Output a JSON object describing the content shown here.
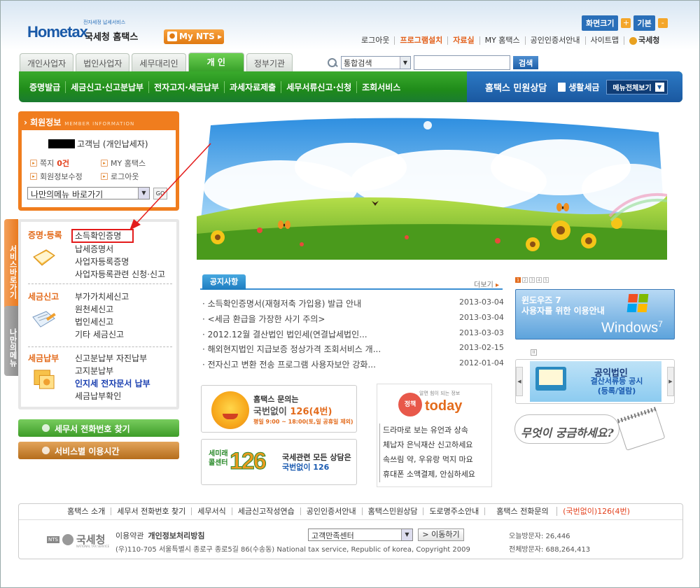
{
  "header": {
    "logo_brand": "Hometax",
    "logo_tag": "전자세정 납세서비스",
    "logo_name": "국세청 홈택스",
    "mynts_label": "My NTS",
    "font_size_label": "화면크기",
    "font_plus": "+",
    "font_default": "기본",
    "font_minus": "-",
    "top_links": [
      "로그아웃",
      "프로그램설치",
      "자료실",
      "MY 홈택스",
      "공인인증서안내",
      "사이트맵"
    ],
    "nts_badge": "국세청"
  },
  "tabs": [
    {
      "label": "개인사업자",
      "active": false
    },
    {
      "label": "법인사업자",
      "active": false
    },
    {
      "label": "세무대리인",
      "active": false
    },
    {
      "label": "개 인",
      "active": true
    },
    {
      "label": "정부기관",
      "active": false
    }
  ],
  "search": {
    "scope_value": "통합검색",
    "button_label": "검색"
  },
  "gnb": {
    "items": [
      "증명발급",
      "세금신고·신고분납부",
      "전자고지·세금납부",
      "과세자료제출",
      "세무서류신고·신청",
      "조회서비스"
    ],
    "cs_label": "홈택스 민원상담",
    "life_tax_label": "생활세금",
    "all_menu_label": "메뉴전체보기"
  },
  "member": {
    "title": "회원정보",
    "title_en": "MEMBER INFORMATION",
    "user_suffix": "고객님 (개인납세자)",
    "note_label": "쪽지",
    "note_count": "0건",
    "my_hometax": "MY 홈택스",
    "edit_info": "회원정보수정",
    "logout": "로그아웃",
    "quick_menu": "나만의메뉴 바로가기",
    "go_label": "GO"
  },
  "service": {
    "side_tab_active": "서비스바로가기",
    "side_tab_inactive": "나만의메뉴",
    "sections": [
      {
        "category": "증명·등록",
        "items": [
          "소득확인증명",
          "납세증명서",
          "사업자등록증명",
          "사업자등록관련 신청·신고"
        ]
      },
      {
        "category": "세금신고",
        "items": [
          "부가가치세신고",
          "원천세신고",
          "법인세신고",
          "기타 세금신고"
        ]
      },
      {
        "category": "세금납부",
        "items": [
          "신고분납부 자진납부",
          "고지분납부",
          "인지세 전자문서 납부",
          "세금납부확인"
        ]
      }
    ]
  },
  "buttons": {
    "tax_office_phone": "세무서 전화번호 찾기",
    "service_hours": "서비스별 이용시간"
  },
  "notice": {
    "tab_label": "공지사항",
    "more_label": "더보기",
    "rows": [
      {
        "title": "소득확인증명서(재형저축 가입용) 발급 안내",
        "date": "2013-03-04"
      },
      {
        "title": "<세금 환급을 가장한 사기 주의>",
        "date": "2013-03-04"
      },
      {
        "title": "2012.12월 결산법인 법인세(연결납세법인...",
        "date": "2013-03-03"
      },
      {
        "title": "해외현지법인 지급보증 정상가격 조회서비스 개...",
        "date": "2013-02-15"
      },
      {
        "title": "전자신고 변환 전송 프로그램 사용자보안 강화...",
        "date": "2012-01-04"
      }
    ]
  },
  "call_banner": {
    "line1": "홈택스 문의는",
    "line2_a": "국번없이 ",
    "line2_b": "126(4번)",
    "line3": "평일 9:00 ~ 18:00(토,일 공휴일 제외)"
  },
  "center_banner": {
    "logo": "세미래 콜센터",
    "number": "126",
    "line1": "국세관련 모든 상담은",
    "line2": "국번없이 126"
  },
  "today": {
    "subtitle": "알면 힘이 되는 정보",
    "badge": "정책",
    "word": "today",
    "items": [
      "드라마로 보는 유언과 상속",
      "체납자 은닉재산 신고하세요",
      "속쓰림 약, 우유랑 먹지 마요",
      "휴대폰 소액결제, 안심하세요"
    ]
  },
  "pager": {
    "pages": [
      "1",
      "2",
      "3",
      "4",
      "5"
    ],
    "active": "1"
  },
  "win7": {
    "line1": "윈도우즈 7",
    "line2": "사용자를 위한 이용안내",
    "word": "Windows",
    "version": "7"
  },
  "gongik": {
    "title": "공익법인",
    "line1": "결산서류등 공시",
    "line2": "(등록/열람)"
  },
  "faq": {
    "text": "무엇이 궁금하세요?"
  },
  "footer": {
    "links": [
      "홈택스 소개",
      "세무서 전화번호 찾기",
      "세무서식",
      "세금신고작성연습",
      "공인인증서안내",
      "홈택스민원상담",
      "도로명주소안내",
      "홈택스 전화문의"
    ],
    "phone": "(국번없이)126(4번)",
    "nts_badge": "NTS",
    "nts_name": "국세청",
    "nts_sub": "NATIONAL TAX SERVICE",
    "terms": "이용약관",
    "privacy": "개인정보처리방침",
    "address": "(우)110-705 서울특별시 종로구 종로5길 86(수송동)   National tax service, Republic of korea, Copyright 2009",
    "family_select": "고객만족센터",
    "go_label": "> 이동하기",
    "today_visitors": "오늘방문자: 26,446",
    "total_visitors": "전체방문자: 688,264,413"
  }
}
